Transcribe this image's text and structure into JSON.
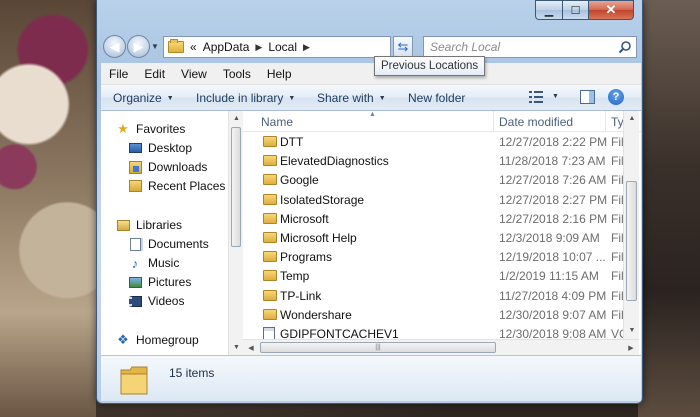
{
  "window": {
    "caption": {
      "minimize": "▁",
      "maximize": "☐",
      "close": "✕"
    }
  },
  "navigation": {
    "back_arrow": "◀",
    "forward_arrow": "▶",
    "recent_dropdown": "▼",
    "breadcrumb": {
      "overflow": "«",
      "parts": [
        "AppData",
        "Local"
      ],
      "separator": "▶"
    },
    "address_dropdown": "▼",
    "refresh_icon": "⇆",
    "search_placeholder": "Search Local",
    "tooltip": "Previous Locations"
  },
  "menu": [
    "File",
    "Edit",
    "View",
    "Tools",
    "Help"
  ],
  "commands": {
    "organize": "Organize",
    "include_in_library": "Include in library",
    "share_with": "Share with",
    "new_folder": "New folder",
    "dropdown_arrow": "▼",
    "help": "?"
  },
  "nav_pane": {
    "favorites": {
      "label": "Favorites",
      "items": [
        {
          "label": "Desktop",
          "icon": "desktop-icon"
        },
        {
          "label": "Downloads",
          "icon": "downloads-icon"
        },
        {
          "label": "Recent Places",
          "icon": "recent-places-icon"
        }
      ]
    },
    "libraries": {
      "label": "Libraries",
      "items": [
        {
          "label": "Documents",
          "icon": "documents-icon"
        },
        {
          "label": "Music",
          "icon": "music-icon"
        },
        {
          "label": "Pictures",
          "icon": "pictures-icon"
        },
        {
          "label": "Videos",
          "icon": "videos-icon"
        }
      ]
    },
    "homegroup": {
      "label": "Homegroup"
    }
  },
  "file_list": {
    "columns": {
      "name": "Name",
      "date_modified": "Date modified",
      "type": "Typ"
    },
    "rows": [
      {
        "name": "DTT",
        "date": "12/27/2018 2:22 PM",
        "type": "File",
        "kind": "folder"
      },
      {
        "name": "ElevatedDiagnostics",
        "date": "11/28/2018 7:23 AM",
        "type": "File",
        "kind": "folder"
      },
      {
        "name": "Google",
        "date": "12/27/2018 7:26 AM",
        "type": "File",
        "kind": "folder"
      },
      {
        "name": "IsolatedStorage",
        "date": "12/27/2018 2:27 PM",
        "type": "File",
        "kind": "folder"
      },
      {
        "name": "Microsoft",
        "date": "12/27/2018 2:16 PM",
        "type": "File",
        "kind": "folder"
      },
      {
        "name": "Microsoft Help",
        "date": "12/3/2018 9:09 AM",
        "type": "File",
        "kind": "folder"
      },
      {
        "name": "Programs",
        "date": "12/19/2018 10:07 ...",
        "type": "File",
        "kind": "folder"
      },
      {
        "name": "Temp",
        "date": "1/2/2019 11:15 AM",
        "type": "File",
        "kind": "folder"
      },
      {
        "name": "TP-Link",
        "date": "11/27/2018 4:09 PM",
        "type": "File",
        "kind": "folder"
      },
      {
        "name": "Wondershare",
        "date": "12/30/2018 9:07 AM",
        "type": "File",
        "kind": "folder"
      },
      {
        "name": "GDIPFONTCACHEV1",
        "date": "12/30/2018 9:08 AM",
        "type": "VC",
        "kind": "file"
      }
    ]
  },
  "status": {
    "item_count": "15 items"
  },
  "colors": {
    "accent": "#2b6ac2",
    "folder": "#e9c35a",
    "frame": "#b9d1ea"
  }
}
